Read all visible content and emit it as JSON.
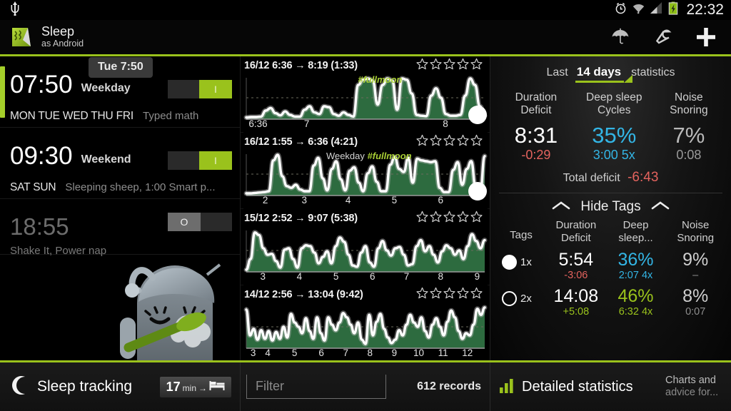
{
  "statusbar": {
    "clock": "22:32",
    "icons": [
      "usb-icon",
      "alarm-clock-icon",
      "wifi-icon",
      "signal-icon",
      "battery-charging-icon"
    ]
  },
  "actionbar": {
    "title": "Sleep",
    "subtitle": "as Android",
    "actions": [
      {
        "name": "umbrella-icon",
        "label": "Umbrella"
      },
      {
        "name": "wrench-icon",
        "label": "Settings"
      },
      {
        "name": "plus-icon",
        "label": "Add alarm"
      }
    ]
  },
  "alarms": {
    "tooltip": "Tue 7:50",
    "items": [
      {
        "time": "07:50",
        "name": "Weekday",
        "days": "MON TUE WED THU FRI",
        "detail": "Typed math",
        "enabled": true,
        "toggle_label": "I"
      },
      {
        "time": "09:30",
        "name": "Weekend",
        "days": "SAT SUN",
        "detail": "Sleeping sheep, 1:00 Smart p...",
        "enabled": true,
        "toggle_label": "I"
      },
      {
        "time": "18:55",
        "name": "",
        "days": "",
        "detail": "Shake It, Power nap",
        "enabled": false,
        "toggle_label": "O"
      }
    ]
  },
  "graphs": [
    {
      "title": "16/12 6:36 → 8:19 (1:33)",
      "stars": 5,
      "stars_filled": 0,
      "tags": [
        {
          "text": "#fullmoon",
          "kind": "tag",
          "pos": 47
        }
      ],
      "axis_labels": [
        {
          "text": "6:36",
          "pos": 6
        },
        {
          "text": "7",
          "pos": 26
        },
        {
          "text": "8",
          "pos": 83
        }
      ],
      "has_dot": true,
      "series": [
        0.04,
        0.05,
        0.05,
        0.06,
        0.2,
        0.26,
        0.14,
        0.09,
        0.18,
        0.1,
        0.06,
        0.06,
        0.22,
        0.3,
        0.16,
        0.12,
        0.3,
        0.28,
        0.12,
        0.08,
        0.16,
        0.1,
        0.06,
        0.8,
        0.92,
        0.95,
        0.9,
        0.34,
        0.8,
        0.95,
        0.9,
        0.22,
        0.95,
        0.92,
        0.6,
        0.1,
        0.08,
        0.07,
        0.55,
        0.72,
        0.5,
        0.12,
        0.08,
        0.08,
        0.1,
        0.55,
        0.95,
        0.8,
        0.3,
        0.08
      ]
    },
    {
      "title": "16/12 1:55 → 6:36 (4:21)",
      "stars": 5,
      "stars_filled": 0,
      "tags": [
        {
          "text": "Weekday",
          "kind": "weekday",
          "pos": 34
        },
        {
          "text": "#fullmoon",
          "kind": "tag",
          "pos": 52
        }
      ],
      "axis_labels": [
        {
          "text": "2",
          "pos": 9
        },
        {
          "text": "3",
          "pos": 25
        },
        {
          "text": "4",
          "pos": 43
        },
        {
          "text": "5",
          "pos": 62
        },
        {
          "text": "6",
          "pos": 81
        }
      ],
      "has_dot": true,
      "series": [
        0.05,
        0.05,
        0.06,
        0.07,
        0.08,
        0.1,
        0.82,
        0.95,
        0.45,
        0.22,
        0.18,
        0.25,
        0.14,
        0.1,
        0.1,
        0.7,
        0.88,
        0.4,
        0.12,
        0.62,
        0.8,
        0.38,
        0.12,
        0.58,
        0.66,
        0.3,
        0.1,
        0.52,
        0.68,
        0.32,
        0.1,
        0.1,
        0.72,
        0.9,
        0.62,
        0.55,
        0.88,
        0.3,
        0.86,
        0.82,
        0.8,
        0.78,
        0.8,
        0.18,
        0.08,
        0.08,
        0.6,
        0.78,
        0.25,
        0.62,
        0.8,
        0.2,
        0.08,
        0.92
      ]
    },
    {
      "title": "15/12 2:52 → 9:07 (5:38)",
      "stars": 5,
      "stars_filled": 0,
      "tags": [],
      "axis_labels": [
        {
          "text": "3",
          "pos": 8
        },
        {
          "text": "4",
          "pos": 23
        },
        {
          "text": "5",
          "pos": 38
        },
        {
          "text": "6",
          "pos": 53
        },
        {
          "text": "7",
          "pos": 67
        },
        {
          "text": "8",
          "pos": 81
        },
        {
          "text": "9",
          "pos": 96
        }
      ],
      "has_dot": false,
      "series": [
        0.05,
        0.3,
        0.92,
        0.86,
        0.55,
        0.4,
        0.42,
        0.25,
        0.1,
        0.52,
        0.55,
        0.3,
        0.1,
        0.55,
        0.62,
        0.6,
        0.45,
        0.2,
        0.35,
        0.48,
        0.2,
        0.6,
        0.8,
        0.7,
        0.4,
        0.15,
        0.12,
        0.45,
        0.6,
        0.22,
        0.12,
        0.55,
        0.72,
        0.5,
        0.38,
        0.55,
        0.58,
        0.4,
        0.15,
        0.18,
        0.6,
        0.74,
        0.48,
        0.6,
        0.4,
        0.22,
        0.48,
        0.62,
        0.55,
        0.4,
        0.5,
        0.3,
        0.6,
        0.88,
        0.72,
        0.55,
        0.74
      ]
    },
    {
      "title": "14/12 2:56 → 13:04 (9:42)",
      "stars": 5,
      "stars_filled": 0,
      "tags": [],
      "axis_labels": [
        {
          "text": "3",
          "pos": 4
        },
        {
          "text": "4",
          "pos": 10
        },
        {
          "text": "5",
          "pos": 21
        },
        {
          "text": "6",
          "pos": 32
        },
        {
          "text": "7",
          "pos": 42
        },
        {
          "text": "8",
          "pos": 52
        },
        {
          "text": "9",
          "pos": 62
        },
        {
          "text": "10",
          "pos": 72
        },
        {
          "text": "11",
          "pos": 82
        },
        {
          "text": "12",
          "pos": 92
        }
      ],
      "has_dot": false,
      "series": [
        0.9,
        0.3,
        0.45,
        0.2,
        0.42,
        0.22,
        0.4,
        0.18,
        0.38,
        0.22,
        0.5,
        0.25,
        0.8,
        0.6,
        0.5,
        0.35,
        0.7,
        0.4,
        0.22,
        0.72,
        0.35,
        0.18,
        0.72,
        0.55,
        0.42,
        0.6,
        0.82,
        0.72,
        0.55,
        0.35,
        0.6,
        0.2,
        0.1,
        0.78,
        0.3,
        0.62,
        0.8,
        0.45,
        0.25,
        0.12,
        0.2,
        0.42,
        0.3,
        0.55,
        0.78,
        0.6,
        0.5,
        0.72,
        0.4,
        0.25,
        0.55,
        0.7,
        0.5,
        0.3,
        0.62,
        0.88,
        0.72,
        0.4,
        0.22,
        0.35,
        0.3,
        0.55,
        0.92,
        0.78,
        0.95
      ]
    }
  ],
  "stats": {
    "header_prefix": "Last",
    "period": "14 days",
    "header_suffix": "statistics",
    "columns": [
      {
        "h1": "Duration",
        "h2": "Deficit"
      },
      {
        "h1": "Deep sleep",
        "h2": "Cycles"
      },
      {
        "h1": "Noise",
        "h2": "Snoring"
      }
    ],
    "values": [
      {
        "big": "8:31",
        "big_color": "white",
        "sub": "-0:29",
        "sub_color": "red"
      },
      {
        "big": "35%",
        "big_color": "blue",
        "sub": "3:00 5x",
        "sub_color": "blue"
      },
      {
        "big": "7%",
        "big_color": "grey",
        "sub": "0:08",
        "sub_color": "grey"
      }
    ],
    "total_label": "Total deficit",
    "total_value": "-6:43",
    "hide_tags": "Hide Tags",
    "tags_label": "Tags",
    "tag_columns": [
      {
        "h1": "Duration",
        "h2": "Deficit"
      },
      {
        "h1": "Deep",
        "h2": "sleep..."
      },
      {
        "h1": "Noise",
        "h2": "Snoring"
      }
    ],
    "tag_rows": [
      {
        "bullet": "filled",
        "count": "1x",
        "cells": [
          {
            "v1": "5:54",
            "v1_color": "white",
            "v2": "-3:06",
            "v2_color": "red"
          },
          {
            "v1": "36%",
            "v1_color": "blue",
            "v2": "2:07 4x",
            "v2_color": "blue"
          },
          {
            "v1": "9%",
            "v1_color": "grey",
            "v2": "–",
            "v2_color": "grey"
          }
        ]
      },
      {
        "bullet": "hollow",
        "count": "2x",
        "cells": [
          {
            "v1": "14:08",
            "v1_color": "white",
            "v2": "+5:08",
            "v2_color": "green"
          },
          {
            "v1": "46%",
            "v1_color": "green",
            "v2": "6:32 4x",
            "v2_color": "green"
          },
          {
            "v1": "8%",
            "v1_color": "grey",
            "v2": "0:07",
            "v2_color": "grey"
          }
        ]
      }
    ]
  },
  "bottom": {
    "sleep_tracking": "Sleep tracking",
    "chip_number": "17",
    "chip_unit": "min",
    "chip_arrow": "→",
    "chip_icon": "bed-icon",
    "filter_placeholder": "Filter",
    "records": "612 records",
    "detailed_statistics": "Detailed statistics",
    "advice_line1": "Charts and",
    "advice_line2": "advice for..."
  },
  "colors": {
    "accent_green": "#9ac21c",
    "blue": "#33b5e5",
    "red": "#e4635e",
    "graph_fill": "#2d6b3f"
  }
}
